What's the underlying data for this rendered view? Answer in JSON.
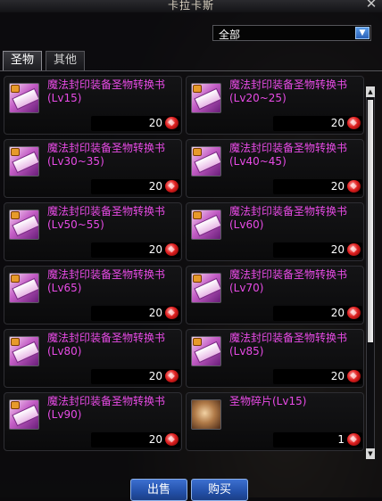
{
  "window": {
    "title": "卡拉卡斯",
    "close_symbol": "✕"
  },
  "filter": {
    "value": "全部",
    "arrow": "▼"
  },
  "tabs": [
    {
      "label": "圣物"
    },
    {
      "label": "其他"
    }
  ],
  "items": [
    {
      "name": "魔法封印装备圣物转换书(Lv15)",
      "price": "20",
      "icon": "seal-scroll-icon"
    },
    {
      "name": "魔法封印装备圣物转换书(Lv20~25)",
      "price": "20",
      "icon": "seal-scroll-icon"
    },
    {
      "name": "魔法封印装备圣物转换书(Lv30~35)",
      "price": "20",
      "icon": "seal-scroll-icon"
    },
    {
      "name": "魔法封印装备圣物转换书(Lv40~45)",
      "price": "20",
      "icon": "seal-scroll-icon"
    },
    {
      "name": "魔法封印装备圣物转换书(Lv50~55)",
      "price": "20",
      "icon": "seal-scroll-icon"
    },
    {
      "name": "魔法封印装备圣物转换书(Lv60)",
      "price": "20",
      "icon": "seal-scroll-icon"
    },
    {
      "name": "魔法封印装备圣物转换书(Lv65)",
      "price": "20",
      "icon": "seal-scroll-icon"
    },
    {
      "name": "魔法封印装备圣物转换书(Lv70)",
      "price": "20",
      "icon": "seal-scroll-icon"
    },
    {
      "name": "魔法封印装备圣物转换书(Lv80)",
      "price": "20",
      "icon": "seal-scroll-icon"
    },
    {
      "name": "魔法封印装备圣物转换书(Lv85)",
      "price": "20",
      "icon": "seal-scroll-icon"
    },
    {
      "name": "魔法封印装备圣物转换书(Lv90)",
      "price": "20",
      "icon": "seal-scroll-icon"
    },
    {
      "name": "圣物碎片(Lv15)",
      "price": "1",
      "icon": "relic-fragment-icon"
    }
  ],
  "colors": {
    "item_name": "#e84be6",
    "button": "#2350a8",
    "price_currency": "#e02020"
  },
  "buttons": {
    "sell": "出售",
    "buy": "购买"
  },
  "scrollbar": {
    "up": "▲",
    "down": "▼"
  }
}
